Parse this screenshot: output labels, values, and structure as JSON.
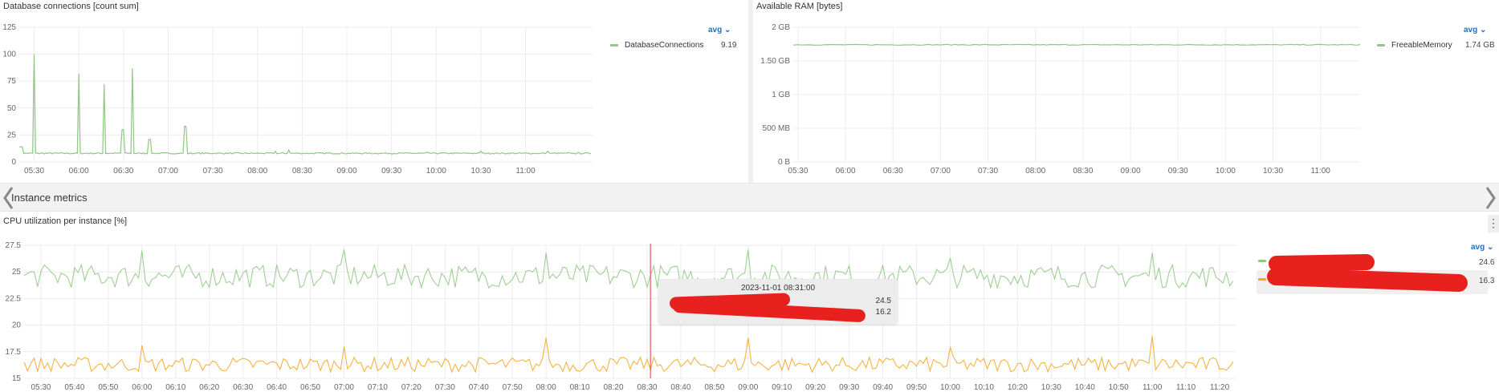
{
  "panels": {
    "db": {
      "title": "Database connections [count sum]",
      "agg": "avg",
      "legend": [
        {
          "name": "DatabaseConnections",
          "value": "9.19",
          "color": "#8fc783"
        }
      ]
    },
    "ram": {
      "title": "Available RAM [bytes]",
      "agg": "avg",
      "legend": [
        {
          "name": "FreeableMemory",
          "value": "1.74 GB",
          "color": "#8fc783"
        }
      ]
    },
    "cpu": {
      "title": "CPU utilization per instance [%]",
      "agg": "avg",
      "legend": [
        {
          "value": "24.6",
          "color": "#8fc783"
        },
        {
          "value": "16.3",
          "color": "#f5a623"
        }
      ],
      "tooltip": {
        "time": "2023-11-01 08:31:00",
        "values": [
          "24.5",
          "16.2"
        ]
      }
    }
  },
  "section": {
    "title": "Instance metrics"
  },
  "icons": {
    "prev": "chevron-left-icon",
    "next": "chevron-right-icon",
    "menu": "more-vertical-icon",
    "agg": "chevron-down-icon"
  },
  "chart_data": [
    {
      "type": "line",
      "title": "Database connections [count sum]",
      "x_ticks": [
        "05:30",
        "06:00",
        "06:30",
        "07:00",
        "07:30",
        "08:00",
        "08:30",
        "09:00",
        "09:30",
        "10:00",
        "10:30",
        "11:00"
      ],
      "ylim": [
        0,
        125
      ],
      "y_ticks": [
        "0",
        "25",
        "50",
        "75",
        "100",
        "125"
      ],
      "grid": true,
      "legend_position": "right",
      "series": [
        {
          "name": "DatabaseConnections",
          "color": "#8fc783",
          "baseline": 8,
          "spikes": [
            [
              5.5,
              100
            ],
            [
              6.0,
              82
            ],
            [
              6.28,
              72
            ],
            [
              6.49,
              30
            ],
            [
              6.6,
              87
            ],
            [
              6.79,
              21
            ],
            [
              7.19,
              33
            ],
            [
              8.2,
              10
            ],
            [
              8.35,
              11
            ],
            [
              9.9,
              9
            ],
            [
              10.5,
              10
            ],
            [
              11.25,
              10
            ]
          ]
        }
      ]
    },
    {
      "type": "line",
      "title": "Available RAM [bytes]",
      "x_ticks": [
        "05:30",
        "06:00",
        "06:30",
        "07:00",
        "07:30",
        "08:00",
        "08:30",
        "09:00",
        "09:30",
        "10:00",
        "10:30",
        "11:00"
      ],
      "ylim": [
        0,
        2
      ],
      "y_ticks": [
        "0 B",
        "500 MB",
        "1 GB",
        "1.50 GB",
        "2 GB"
      ],
      "grid": true,
      "legend_position": "right",
      "series": [
        {
          "name": "FreeableMemory",
          "color": "#8fc783",
          "level": 1.74
        }
      ]
    },
    {
      "type": "line",
      "title": "CPU utilization per instance [%]",
      "x_ticks": [
        "05:30",
        "05:40",
        "05:50",
        "06:00",
        "06:10",
        "06:20",
        "06:30",
        "06:40",
        "06:50",
        "07:00",
        "07:10",
        "07:20",
        "07:30",
        "07:40",
        "07:50",
        "08:00",
        "08:10",
        "08:20",
        "08:30",
        "08:40",
        "08:50",
        "09:00",
        "09:10",
        "09:20",
        "09:30",
        "09:40",
        "09:50",
        "10:00",
        "10:10",
        "10:20",
        "10:30",
        "10:40",
        "10:50",
        "11:00",
        "11:10",
        "11:20"
      ],
      "ylim": [
        15,
        27.5
      ],
      "y_ticks": [
        "15",
        "17.5",
        "20",
        "22.5",
        "25",
        "27.5"
      ],
      "grid": true,
      "legend_position": "right",
      "cursor_time": "08:31",
      "series": [
        {
          "color": "#8fc783",
          "mean": 24.6,
          "amplitude": 1.1,
          "peaks": [
            [
              6.0,
              27.0
            ],
            [
              7.0,
              27.1
            ],
            [
              8.0,
              26.8
            ],
            [
              9.0,
              27.1
            ],
            [
              11.0,
              26.8
            ],
            [
              10.0,
              26.3
            ]
          ]
        },
        {
          "color": "#f5a623",
          "mean": 16.3,
          "amplitude": 0.7,
          "peaks": [
            [
              6.0,
              18.1
            ],
            [
              7.0,
              18.0
            ],
            [
              8.0,
              18.8
            ],
            [
              9.0,
              18.8
            ],
            [
              11.0,
              19.0
            ],
            [
              10.0,
              17.9
            ]
          ]
        }
      ]
    }
  ]
}
